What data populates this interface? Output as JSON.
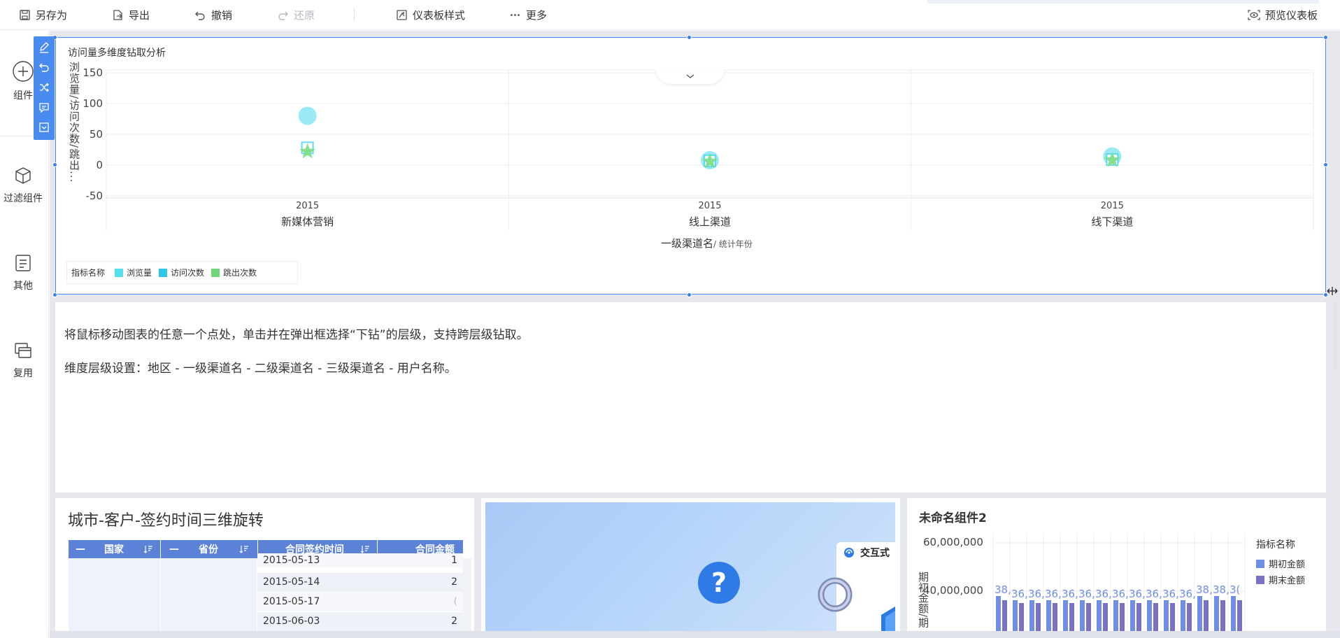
{
  "toolbar": {
    "save_as": "另存为",
    "export": "导出",
    "undo": "撤销",
    "redo": "还原",
    "dashboard_style": "仪表板样式",
    "more": "更多",
    "preview": "预览仪表板"
  },
  "sidebar": {
    "items": [
      {
        "label": "组件",
        "icon": "plus-circle-icon"
      },
      {
        "label": "过滤组件",
        "icon": "cube-icon"
      },
      {
        "label": "其他",
        "icon": "document-icon"
      },
      {
        "label": "复用",
        "icon": "layers-icon"
      }
    ]
  },
  "main_chart": {
    "title": "访问量多维度钻取分析",
    "ylabel": "浏览量/访问次数/跳出...",
    "xlabel": "一级渠道名",
    "xlabel_sub": "/ 统计年份",
    "legend_title": "指标名称",
    "drop_arrow": "chevron-down-icon"
  },
  "chart_data": {
    "type": "scatter",
    "title": "访问量多维度钻取分析",
    "ylabel": "浏览量/访问次数/跳出...",
    "xlabel": "一级渠道名/ 统计年份",
    "yticks": [
      150,
      100,
      50,
      0,
      -50
    ],
    "ylim": [
      -50,
      150
    ],
    "categories": [
      {
        "group": "新媒体营销",
        "year": "2015"
      },
      {
        "group": "线上渠道",
        "year": "2015"
      },
      {
        "group": "线下渠道",
        "year": "2015"
      }
    ],
    "series": [
      {
        "name": "浏览量",
        "shape": "circle",
        "color": "#8ee8f4",
        "values": [
          80,
          8,
          14
        ]
      },
      {
        "name": "访问次数",
        "shape": "square",
        "color": "#54d8f0",
        "values": [
          28,
          7,
          9
        ]
      },
      {
        "name": "跳出次数",
        "shape": "star",
        "color": "#7fdc8a",
        "values": [
          22,
          6,
          8
        ]
      }
    ],
    "grid": true,
    "legend_position": "bottom-left"
  },
  "text_panel": {
    "line1": "将鼠标移动图表的任意一个点处，单击并在弹出框选择“下钻”的层级，支持跨层级钻取。",
    "line2": "维度层级设置：地区 - 一级渠道名 - 二级渠道名 - 三级渠道名 - 用户名称。"
  },
  "table_panel": {
    "title": "城市-客户-签约时间三维旋转",
    "columns": [
      "国家",
      "省份",
      "合同签约时间",
      "合同金额"
    ],
    "rows": [
      {
        "date": "2015-05-13",
        "amount": "1"
      },
      {
        "date": "2015-05-14",
        "amount": "2"
      },
      {
        "date": "2015-05-17",
        "amount": "("
      },
      {
        "date": "2015-06-03",
        "amount": "2"
      }
    ]
  },
  "image_panel": {
    "card_label": "交互式"
  },
  "bar_panel": {
    "title": "未命名组件2",
    "yticks": [
      "60,000,000",
      "40,000,000"
    ],
    "ylabel": "期初金额/期",
    "legend_title": "指标名称",
    "legend": [
      {
        "name": "期初金额",
        "color": "#6f8ee8"
      },
      {
        "name": "期末金额",
        "color": "#7b72c4"
      }
    ],
    "bar_labels": [
      "38,",
      "36,",
      "36,",
      "36,",
      "36,",
      "36,",
      "36,",
      "36,",
      "36,",
      "36,",
      "36,",
      "36,",
      "38,",
      "38,",
      "3("
    ]
  }
}
